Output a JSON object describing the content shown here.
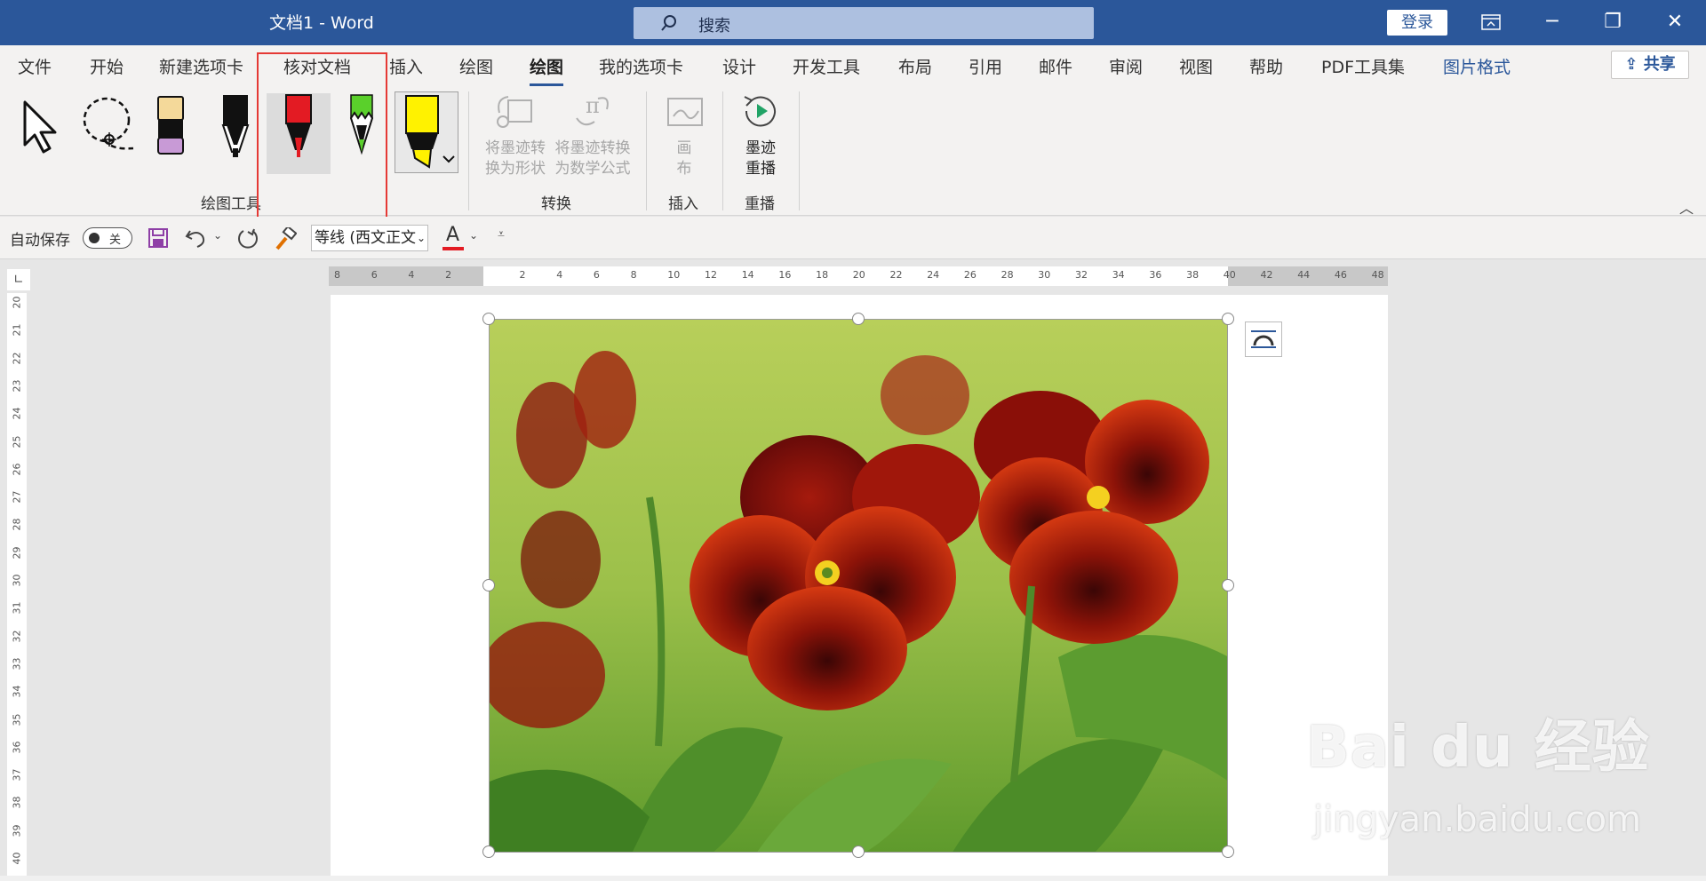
{
  "titlebar": {
    "doc_title": "文档1  -  Word",
    "search_placeholder": "搜索",
    "login_label": "登录"
  },
  "menu": {
    "tabs": [
      "文件",
      "开始",
      "新建选项卡",
      "核对文档",
      "插入",
      "绘图",
      "绘图",
      "我的选项卡",
      "设计",
      "开发工具",
      "布局",
      "引用",
      "邮件",
      "审阅",
      "视图",
      "帮助",
      "PDF工具集",
      "图片格式"
    ],
    "active_tab": "绘图",
    "share_label": "共享"
  },
  "ribbon": {
    "groups": {
      "drawing_tools": "绘图工具",
      "convert": "转换",
      "insert": "插入",
      "replay": "重播"
    },
    "buttons": {
      "ink_to_shape": "将墨迹转换为形状",
      "ink_to_shape_l1": "将墨迹转",
      "ink_to_shape_l2": "换为形状",
      "ink_to_math_l1": "将墨迹转换",
      "ink_to_math_l2": "为数学公式",
      "canvas_l1": "画",
      "canvas_l2": "布",
      "ink_replay_l1": "墨迹",
      "ink_replay_l2": "重播"
    },
    "pens": {
      "pen_black_color": "#111111",
      "pen_red_color": "#e31b23",
      "pen_green_color": "#5ad02b",
      "highlighter_color": "#fff200",
      "eraser_top_color": "#f4d99a",
      "eraser_bottom_color": "#c89ad6"
    }
  },
  "qat": {
    "autosave_label": "自动保存",
    "toggle_state": "关",
    "font_name": "等线 (西文正文",
    "font_color_letter": "A"
  },
  "rulers": {
    "horizontal": [
      "8",
      "6",
      "4",
      "2",
      "",
      "2",
      "4",
      "6",
      "8",
      "10",
      "12",
      "14",
      "16",
      "18",
      "20",
      "22",
      "24",
      "26",
      "28",
      "30",
      "32",
      "34",
      "36",
      "38",
      "40",
      "42",
      "44",
      "46",
      "48"
    ],
    "vertical": [
      "20",
      "21",
      "22",
      "23",
      "24",
      "25",
      "26",
      "27",
      "28",
      "29",
      "30",
      "31",
      "32",
      "33",
      "34",
      "35",
      "36",
      "37",
      "38",
      "39",
      "40"
    ]
  },
  "watermark": {
    "brand": "Bai du 经验",
    "url": "jingyan.baidu.com"
  }
}
